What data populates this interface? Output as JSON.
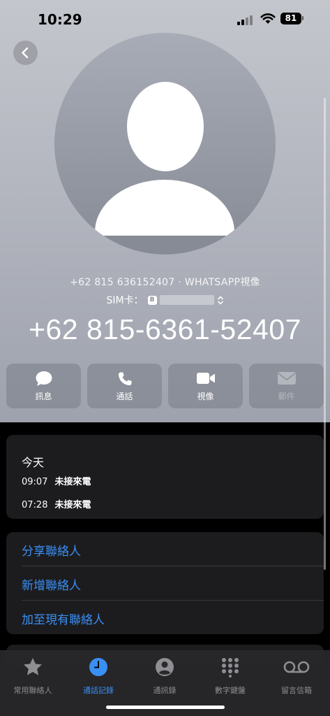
{
  "status_bar": {
    "time": "10:29",
    "battery": "81"
  },
  "contact": {
    "caller_info": "+62 815 636152407 · WHATSAPP視像",
    "sim_label": "SIM卡：",
    "sim_badge": "B",
    "phone_number": "+62 815-6361-52407"
  },
  "actions": [
    {
      "label": "訊息",
      "icon": "message-icon",
      "enabled": true
    },
    {
      "label": "通話",
      "icon": "phone-icon",
      "enabled": true
    },
    {
      "label": "視像",
      "icon": "video-icon",
      "enabled": true
    },
    {
      "label": "郵件",
      "icon": "mail-icon",
      "enabled": false
    }
  ],
  "recents": {
    "title": "今天",
    "calls": [
      {
        "time": "09:07",
        "status": "未接來電"
      },
      {
        "time": "07:28",
        "status": "未接來電"
      }
    ]
  },
  "options": [
    {
      "label": "分享聯絡人"
    },
    {
      "label": "新增聯絡人"
    },
    {
      "label": "加至現有聯絡人"
    }
  ],
  "tab_bar": [
    {
      "label": "常用聯絡人",
      "icon": "star-icon",
      "active": false
    },
    {
      "label": "通話記錄",
      "icon": "clock-icon",
      "active": true
    },
    {
      "label": "通訊錄",
      "icon": "person-icon",
      "active": false
    },
    {
      "label": "數字鍵盤",
      "icon": "keypad-icon",
      "active": false
    },
    {
      "label": "留言信箱",
      "icon": "voicemail-icon",
      "active": false
    }
  ],
  "colors": {
    "accent": "#3a8ff5",
    "card": "#1c1c1e",
    "hero_top": "#c4c6cd",
    "hero_bottom": "#9ea2ad"
  }
}
